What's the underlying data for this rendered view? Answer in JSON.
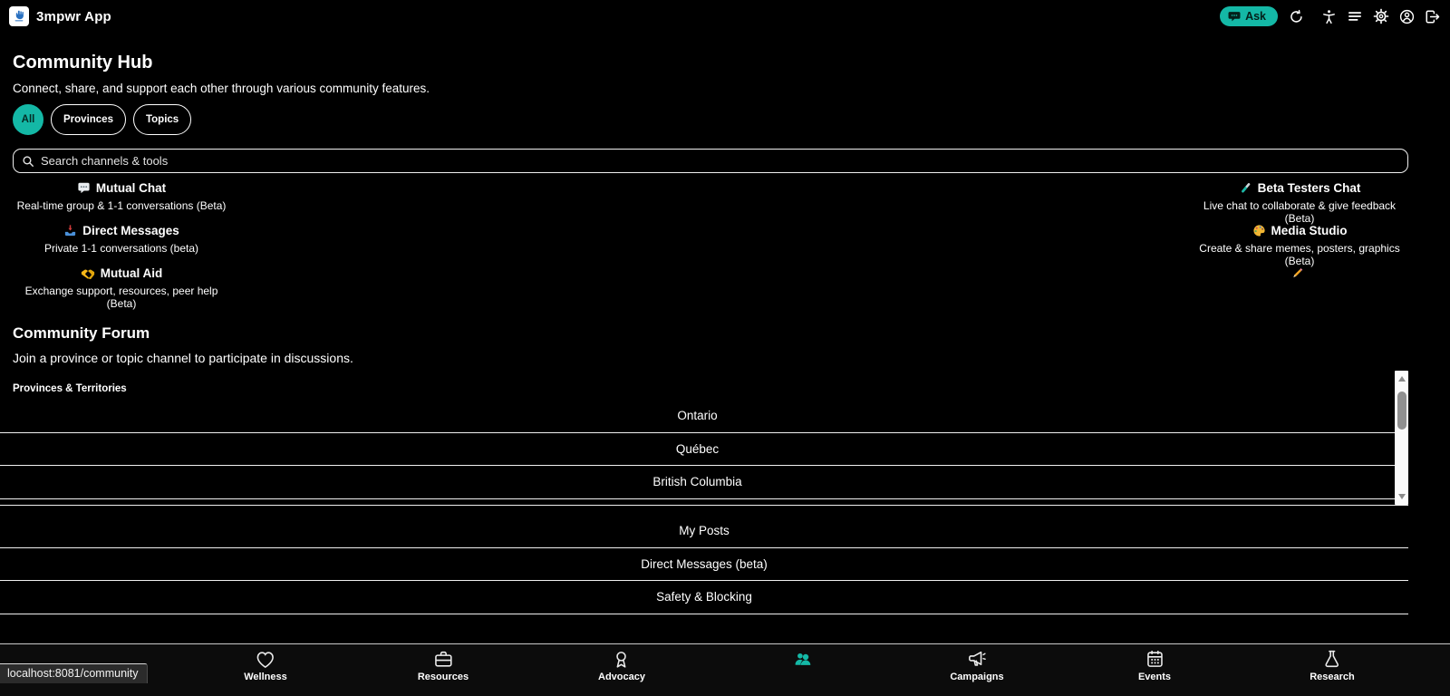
{
  "app": {
    "title": "3mpwr App",
    "logo_icon": "blue-hand-logo"
  },
  "topbar": {
    "ask_label": "Ask",
    "icons": [
      "chat-bubble",
      "refresh",
      "accessibility",
      "menu",
      "settings",
      "account",
      "logout"
    ]
  },
  "community_hub": {
    "title": "Community Hub",
    "subtitle": "Connect, share, and support each other through various community features.",
    "filters": [
      {
        "label": "All",
        "active": true
      },
      {
        "label": "Provinces",
        "active": false
      },
      {
        "label": "Topics",
        "active": false
      }
    ],
    "search_placeholder": "Search channels & tools",
    "channels": [
      {
        "icon": "speech-balloon",
        "title": "Mutual Chat",
        "description": "Real-time group & 1-1 conversations (Beta)"
      },
      {
        "icon": "test-tube",
        "title": "Beta Testers Chat",
        "description": "Live chat to collaborate & give feedback (Beta)"
      },
      {
        "icon": "inbox-tray",
        "title": "Direct Messages",
        "description": "Private 1-1 conversations (beta)"
      },
      {
        "icon": "artist-palette",
        "title": "Media Studio",
        "description": "Create & share memes, posters, graphics (Beta)"
      },
      {
        "icon": "handshake",
        "title": "Mutual Aid",
        "description": "Exchange support, resources, peer help (Beta)"
      },
      {
        "icon": "pencil",
        "title": "",
        "description": ""
      }
    ]
  },
  "community_forum": {
    "title": "Community Forum",
    "subtitle": "Join a province or topic channel to participate in discussions.",
    "section_label": "Provinces & Territories",
    "provinces": [
      "Ontario",
      "Québec",
      "British Columbia"
    ],
    "links": [
      "My Posts",
      "Direct Messages (beta)",
      "Safety & Blocking"
    ]
  },
  "bottom_nav": {
    "items": [
      {
        "icon": "heart",
        "label": "Wellness",
        "active": false
      },
      {
        "icon": "briefcase",
        "label": "Resources",
        "active": false
      },
      {
        "icon": "award-ribbon",
        "label": "Advocacy",
        "active": false
      },
      {
        "icon": "people",
        "label": "",
        "active": true
      },
      {
        "icon": "megaphone",
        "label": "Campaigns",
        "active": false
      },
      {
        "icon": "calendar",
        "label": "Events",
        "active": false
      },
      {
        "icon": "flask",
        "label": "Research",
        "active": false
      }
    ]
  },
  "status_bar": {
    "url": "localhost:8081/community"
  },
  "colors": {
    "accent": "#14b8a6",
    "background": "#000000",
    "nav_background": "#0c0c0c",
    "separator": "#f0f0f0"
  }
}
